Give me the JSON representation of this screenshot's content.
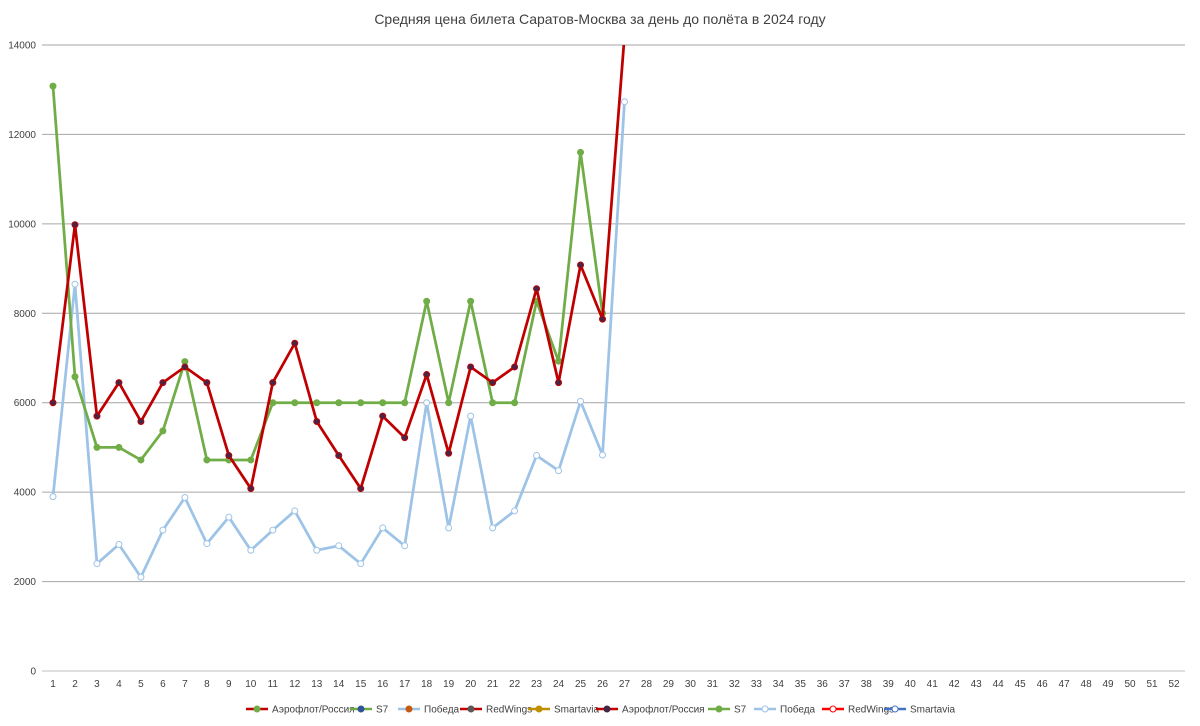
{
  "chart_data": {
    "type": "line",
    "title": "Средняя цена билета Саратов-Москва за день до полёта в 2024 году",
    "xlabel": "",
    "ylabel": "",
    "ylim": [
      0,
      14000
    ],
    "yticks": [
      0,
      2000,
      4000,
      6000,
      8000,
      10000,
      12000,
      14000
    ],
    "grid": true,
    "legend_position": "bottom",
    "x": [
      1,
      2,
      3,
      4,
      5,
      6,
      7,
      8,
      9,
      10,
      11,
      12,
      13,
      14,
      15,
      16,
      17,
      18,
      19,
      20,
      21,
      22,
      23,
      24,
      25,
      26,
      27,
      28,
      29,
      30,
      31,
      32,
      33,
      34,
      35,
      36,
      37,
      38,
      39,
      40,
      41,
      42,
      43,
      44,
      45,
      46,
      47,
      48,
      49,
      50,
      51,
      52
    ],
    "series": [
      {
        "name": "Аэрофлот/Россия",
        "color": "#c00000",
        "marker_fill": "#70ad47",
        "visible_line": false,
        "values": []
      },
      {
        "name": "S7",
        "color": "#70ad47",
        "marker_fill": "#2f5597",
        "visible_line": false,
        "values": []
      },
      {
        "name": "Победа",
        "color": "#9dc3e6",
        "marker_fill": "#c55a11",
        "visible_line": false,
        "values": []
      },
      {
        "name": "RedWings",
        "color": "#c00000",
        "marker_fill": "#595959",
        "visible_line": false,
        "values": []
      },
      {
        "name": "Smartavia",
        "color": "#bf9000",
        "marker_fill": "#bf9000",
        "visible_line": false,
        "values": []
      },
      {
        "name": "Аэрофлот/Россия",
        "color": "#c00000",
        "marker_fill": "#44264a",
        "visible_line": true,
        "values": [
          6000,
          9980,
          5700,
          6450,
          5580,
          6450,
          6800,
          6450,
          4820,
          4080,
          6450,
          7330,
          5580,
          4820,
          4080,
          5700,
          5220,
          6630,
          4870,
          6800,
          6450,
          6800,
          8550,
          6450,
          9080,
          7870,
          14200
        ]
      },
      {
        "name": "S7",
        "color": "#70ad47",
        "marker_fill": "#70ad47",
        "visible_line": true,
        "values": [
          13080,
          6580,
          5000,
          5000,
          4720,
          5370,
          6920,
          4720,
          4720,
          4720,
          6000,
          6000,
          6000,
          6000,
          6000,
          6000,
          6000,
          8270,
          6000,
          8270,
          6000,
          6000,
          8270,
          6930,
          11600,
          8000
        ]
      },
      {
        "name": "Победа",
        "color": "#9dc3e6",
        "marker_fill": "#ffffff",
        "visible_line": true,
        "values": [
          3900,
          8650,
          2400,
          2830,
          2100,
          3150,
          3880,
          2850,
          3440,
          2700,
          3150,
          3580,
          2700,
          2800,
          2400,
          3200,
          2800,
          6000,
          3200,
          5700,
          3200,
          3580,
          4820,
          4480,
          6030,
          4830,
          12730
        ]
      },
      {
        "name": "RedWings",
        "color": "#ff0000",
        "marker_fill": "#ffffff",
        "visible_line": false,
        "values": []
      },
      {
        "name": "Smartavia",
        "color": "#4472c4",
        "marker_fill": "#ffffff",
        "visible_line": false,
        "values": []
      }
    ]
  }
}
